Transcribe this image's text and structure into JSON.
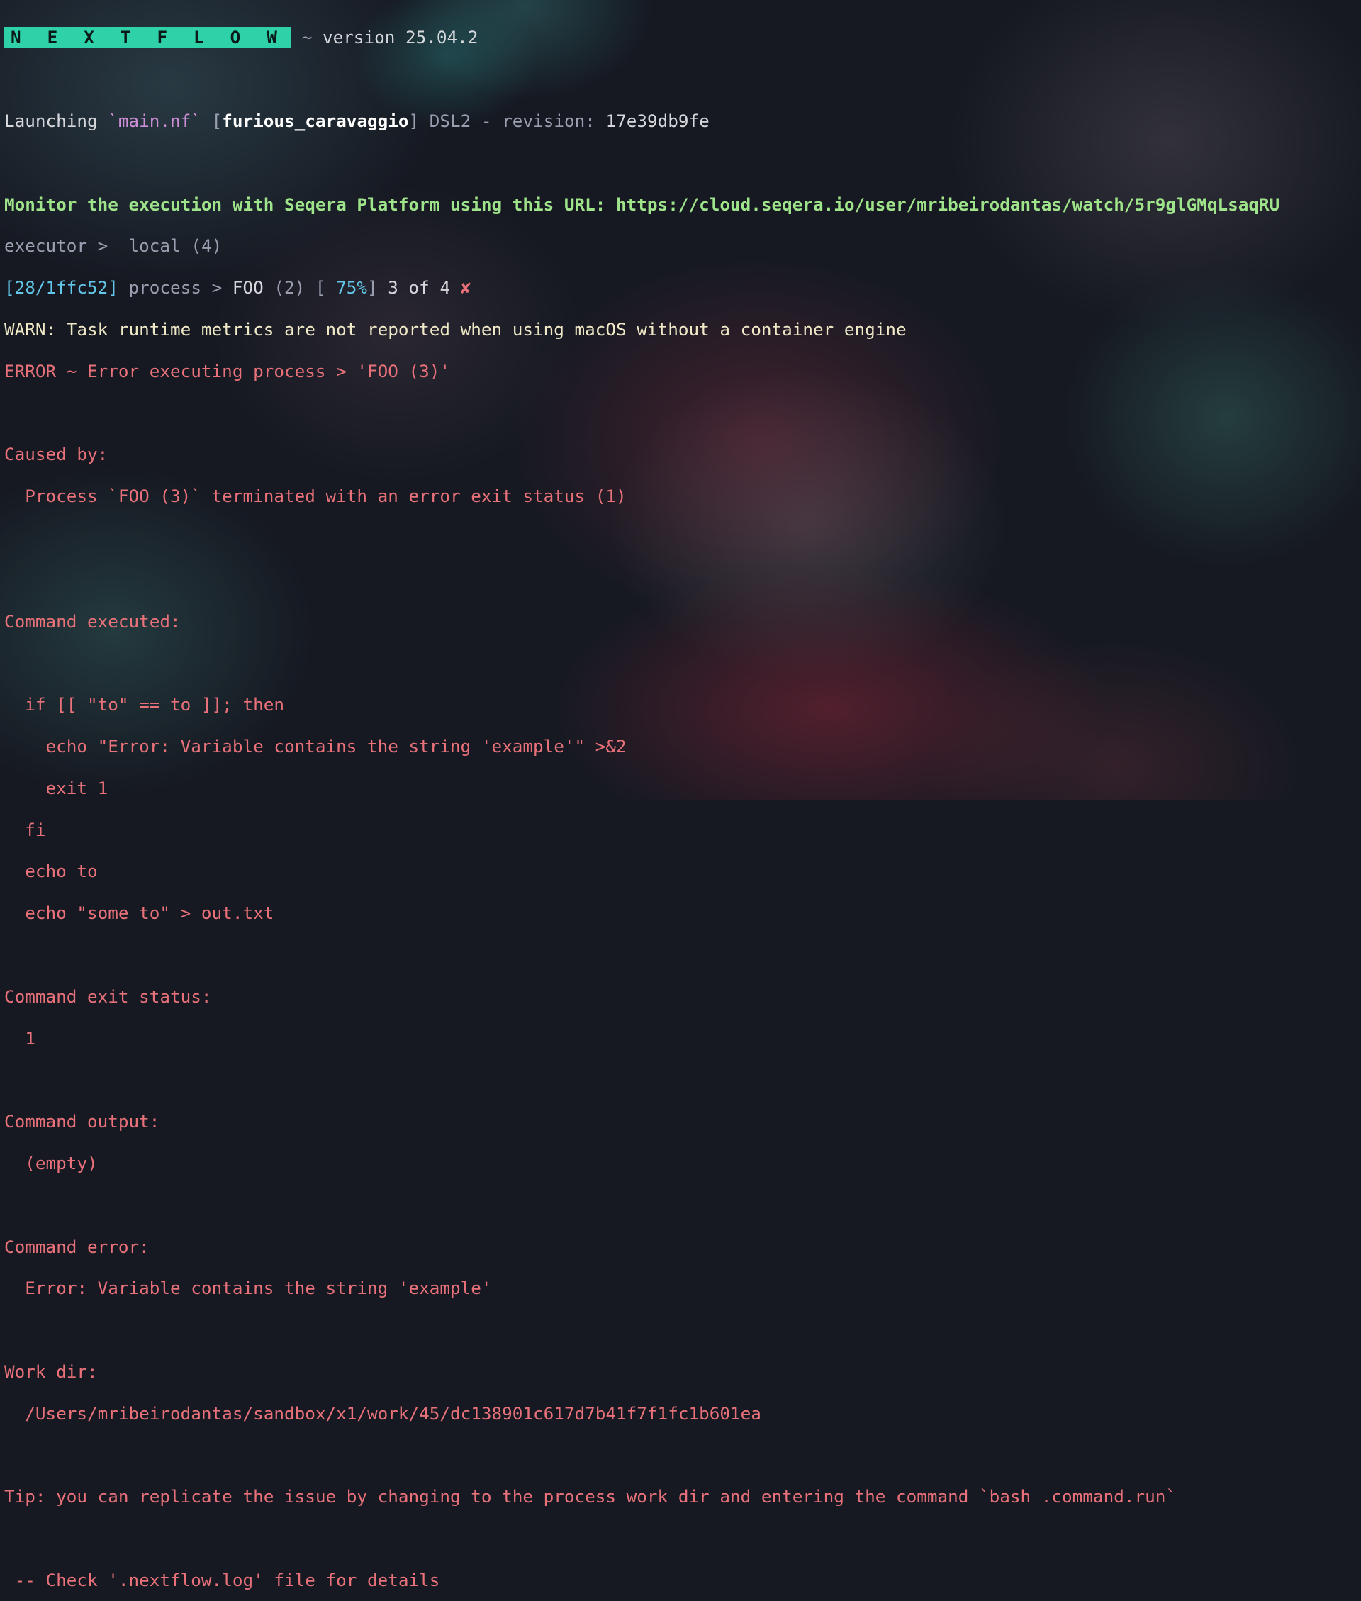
{
  "header": {
    "logo": "N E X T F L O W",
    "tilde": "~",
    "version": "version 25.04.2"
  },
  "launch": {
    "prefix": "Launching ",
    "script": "`main.nf`",
    "open_bracket": " [",
    "run_name": "furious_caravaggio",
    "close_bracket": "] ",
    "dsl": "DSL2 - revision: ",
    "revision": "17e39db9fe"
  },
  "monitor": {
    "text": "Monitor the execution with Seqera Platform using this URL: https://cloud.seqera.io/user/mribeirodantas/watch/5r9glGMqLsaqRU"
  },
  "executor": {
    "label": "executor > ",
    "value": " local (4)"
  },
  "process": {
    "hash": "[28/1ffc52]",
    "label": " process > ",
    "name": "FOO",
    "index": " (2) ",
    "progress_open": "[ ",
    "percent": "75%",
    "progress_close": "]",
    "count": " 3 of 4 ",
    "fail_mark": "✘"
  },
  "messages": {
    "warn": "WARN: Task runtime metrics are not reported when using macOS without a container engine",
    "error": "ERROR ~ Error executing process > 'FOO (3)'",
    "caused_by": "Caused by:",
    "caused_detail": "  Process `FOO (3)` terminated with an error exit status (1)",
    "command_executed": "Command executed:",
    "command_lines": [
      "  if [[ \"to\" == to ]]; then",
      "    echo \"Error: Variable contains the string 'example'\" >&2",
      "    exit 1",
      "  fi",
      "  echo to",
      "  echo \"some to\" > out.txt"
    ],
    "exit_status_label": "Command exit status:",
    "exit_status_value": "  1",
    "output_label": "Command output:",
    "output_value": "  (empty)",
    "error_label": "Command error:",
    "error_value": "  Error: Variable contains the string 'example'",
    "workdir_label": "Work dir:",
    "workdir_value": "  /Users/mribeirodantas/sandbox/x1/work/45/dc138901c617d7b41f7f1fc1b601ea",
    "tip": "Tip: you can replicate the issue by changing to the process work dir and entering the command `bash .command.run`",
    "check": " -- Check '.nextflow.log' file for details"
  },
  "colors": {
    "background": "#161922",
    "logo_bg": "#2fd1a8",
    "error_red": "#e8717a",
    "monitor_green": "#9fe38a",
    "percent_cyan": "#62c7e8"
  }
}
